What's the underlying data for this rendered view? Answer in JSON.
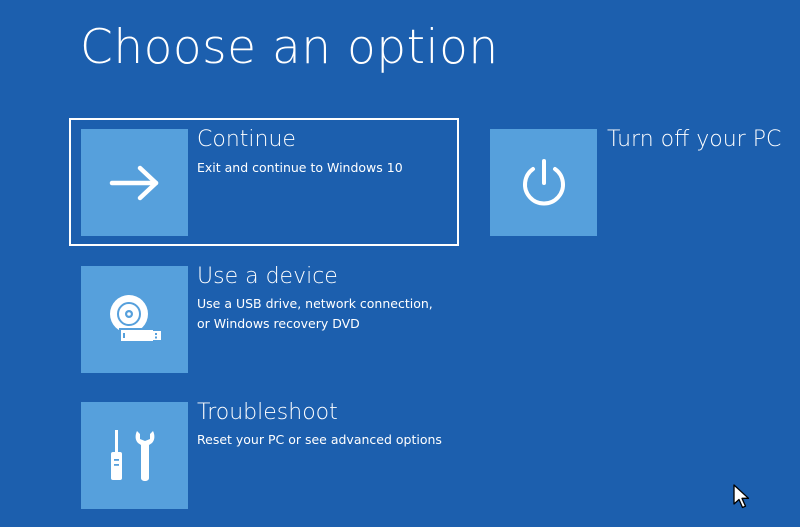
{
  "page_title": "Choose an option",
  "options": [
    {
      "title": "Continue",
      "description": "Exit and continue to Windows 10",
      "icon": "arrow-right-icon"
    },
    {
      "title": "Turn off your PC",
      "description": "",
      "icon": "power-icon"
    },
    {
      "title": "Use a device",
      "description_line1": "Use a USB drive, network connection,",
      "description_line2": "or Windows recovery DVD",
      "icon": "usb-disc-icon"
    },
    {
      "title": "Troubleshoot",
      "description": "Reset your PC or see advanced options",
      "icon": "tools-icon"
    }
  ],
  "colors": {
    "background": "#1c5fae",
    "tile": "#56a0dc",
    "text": "#ffffff"
  }
}
